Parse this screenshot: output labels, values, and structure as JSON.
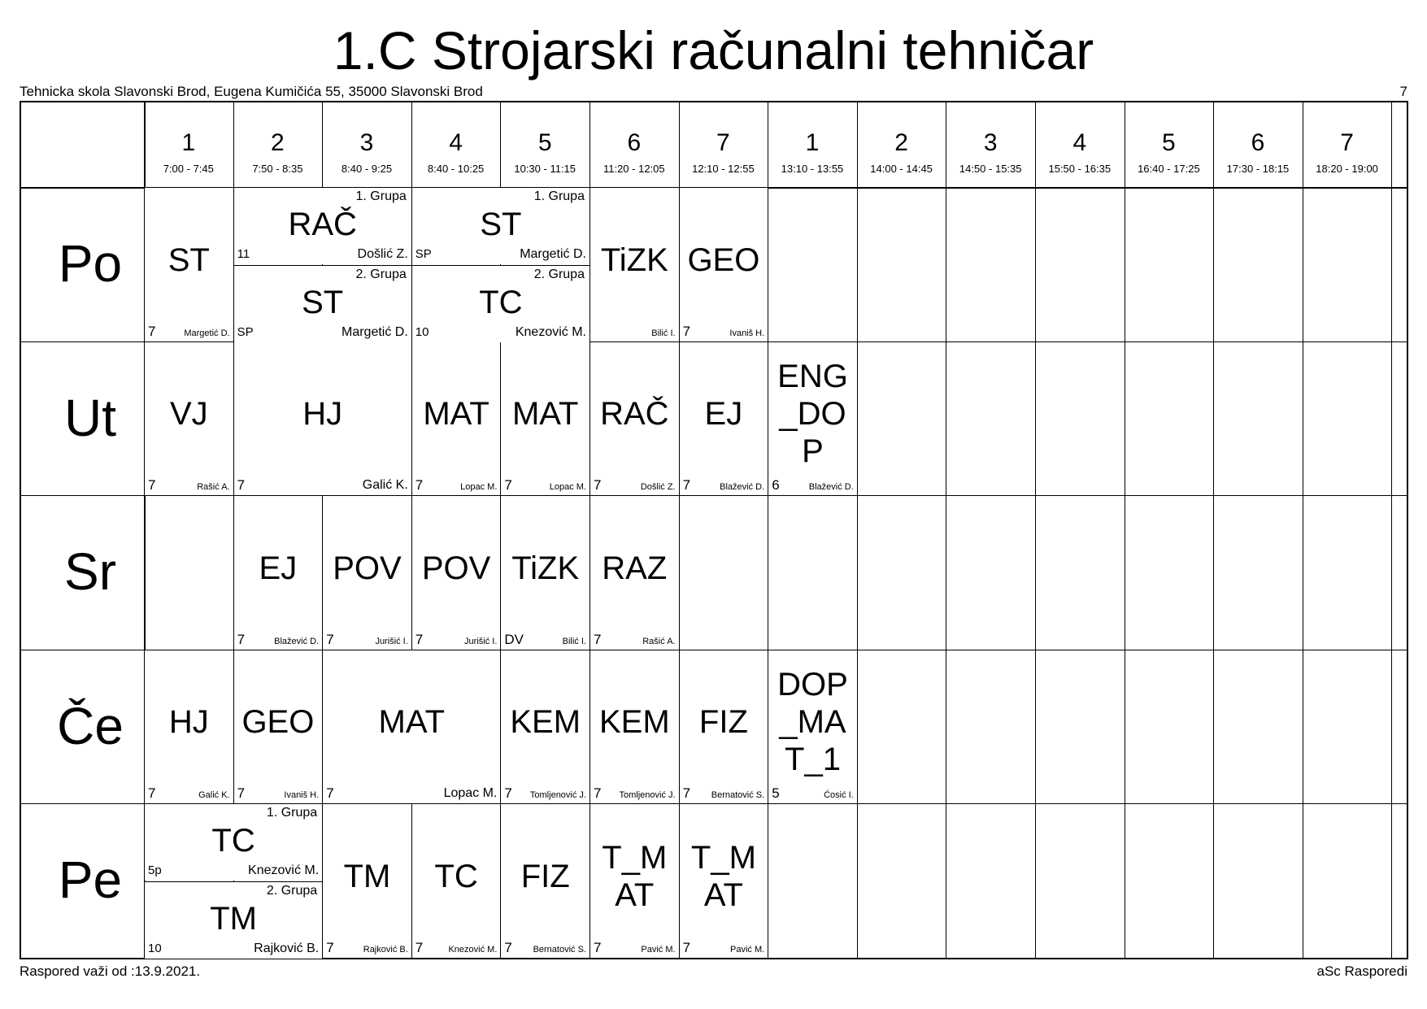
{
  "title": "1.C Strojarski računalni tehničar",
  "school": "Tehnicka skola Slavonski Brod, Eugena Kumičića 55, 35000 Slavonski Brod",
  "page_number": "7",
  "footer_left": "Raspored važi od :13.9.2021.",
  "footer_right": "aSc Rasporedi",
  "periods": [
    {
      "num": "1",
      "time": "7:00 - 7:45"
    },
    {
      "num": "2",
      "time": "7:50 - 8:35"
    },
    {
      "num": "3",
      "time": "8:40 - 9:25"
    },
    {
      "num": "4",
      "time": "8:40 - 10:25"
    },
    {
      "num": "5",
      "time": "10:30 - 11:15"
    },
    {
      "num": "6",
      "time": "11:20 - 12:05"
    },
    {
      "num": "7",
      "time": "12:10 - 12:55"
    },
    {
      "num": "1",
      "time": "13:10 - 13:55"
    },
    {
      "num": "2",
      "time": "14:00 - 14:45"
    },
    {
      "num": "3",
      "time": "14:50 - 15:35"
    },
    {
      "num": "4",
      "time": "15:50 - 16:35"
    },
    {
      "num": "5",
      "time": "16:40 - 17:25"
    },
    {
      "num": "6",
      "time": "17:30 - 18:15"
    },
    {
      "num": "7",
      "time": "18:20 - 19:00"
    }
  ],
  "days": [
    "Po",
    "Ut",
    "Sr",
    "Če",
    "Pe"
  ],
  "lessons": [
    {
      "day": 0,
      "start": 0,
      "span": 1,
      "half": "",
      "subject": [
        "ST"
      ],
      "room": "7",
      "teacher": "Margetić D.",
      "group": ""
    },
    {
      "day": 0,
      "start": 1,
      "span": 2,
      "half": "top",
      "subject": [
        "RAČ"
      ],
      "room": "11",
      "teacher": "Došlić Z.",
      "group": "1. Grupa"
    },
    {
      "day": 0,
      "start": 1,
      "span": 2,
      "half": "bottom",
      "subject": [
        "ST"
      ],
      "room": "SP",
      "teacher": "Margetić D.",
      "group": "2. Grupa"
    },
    {
      "day": 0,
      "start": 3,
      "span": 2,
      "half": "top",
      "subject": [
        "ST"
      ],
      "room": "SP",
      "teacher": "Margetić D.",
      "group": "1. Grupa"
    },
    {
      "day": 0,
      "start": 3,
      "span": 2,
      "half": "bottom",
      "subject": [
        "TC"
      ],
      "room": "10",
      "teacher": "Knezović M.",
      "group": "2. Grupa"
    },
    {
      "day": 0,
      "start": 5,
      "span": 1,
      "half": "",
      "subject": [
        "TiZK"
      ],
      "room": "",
      "teacher": "Bilić I.",
      "group": ""
    },
    {
      "day": 0,
      "start": 6,
      "span": 1,
      "half": "",
      "subject": [
        "GEO"
      ],
      "room": "7",
      "teacher": "Ivaniš H.",
      "group": ""
    },
    {
      "day": 1,
      "start": 0,
      "span": 1,
      "half": "",
      "subject": [
        "VJ"
      ],
      "room": "7",
      "teacher": "Rašić A.",
      "group": ""
    },
    {
      "day": 1,
      "start": 1,
      "span": 2,
      "half": "",
      "subject": [
        "HJ"
      ],
      "room": "7",
      "teacher": "Galić K.",
      "group": ""
    },
    {
      "day": 1,
      "start": 3,
      "span": 1,
      "half": "",
      "subject": [
        "MAT"
      ],
      "room": "7",
      "teacher": "Lopac M.",
      "group": ""
    },
    {
      "day": 1,
      "start": 4,
      "span": 1,
      "half": "",
      "subject": [
        "MAT"
      ],
      "room": "7",
      "teacher": "Lopac M.",
      "group": ""
    },
    {
      "day": 1,
      "start": 5,
      "span": 1,
      "half": "",
      "subject": [
        "RAČ"
      ],
      "room": "7",
      "teacher": "Došlić Z.",
      "group": ""
    },
    {
      "day": 1,
      "start": 6,
      "span": 1,
      "half": "",
      "subject": [
        "EJ"
      ],
      "room": "7",
      "teacher": "Blažević D.",
      "group": ""
    },
    {
      "day": 1,
      "start": 7,
      "span": 1,
      "half": "",
      "subject": [
        "ENG",
        "_DO",
        "P"
      ],
      "room": "6",
      "teacher": "Blažević D.",
      "group": ""
    },
    {
      "day": 2,
      "start": 1,
      "span": 1,
      "half": "",
      "subject": [
        "EJ"
      ],
      "room": "7",
      "teacher": "Blažević D.",
      "group": ""
    },
    {
      "day": 2,
      "start": 2,
      "span": 1,
      "half": "",
      "subject": [
        "POV"
      ],
      "room": "7",
      "teacher": "Jurišić I.",
      "group": ""
    },
    {
      "day": 2,
      "start": 3,
      "span": 1,
      "half": "",
      "subject": [
        "POV"
      ],
      "room": "7",
      "teacher": "Jurišić I.",
      "group": ""
    },
    {
      "day": 2,
      "start": 4,
      "span": 1,
      "half": "",
      "subject": [
        "TiZK"
      ],
      "room": "DV",
      "teacher": "Bilić I.",
      "group": ""
    },
    {
      "day": 2,
      "start": 5,
      "span": 1,
      "half": "",
      "subject": [
        "RAZ"
      ],
      "room": "7",
      "teacher": "Rašić A.",
      "group": ""
    },
    {
      "day": 3,
      "start": 0,
      "span": 1,
      "half": "",
      "subject": [
        "HJ"
      ],
      "room": "7",
      "teacher": "Galić K.",
      "group": ""
    },
    {
      "day": 3,
      "start": 1,
      "span": 1,
      "half": "",
      "subject": [
        "GEO"
      ],
      "room": "7",
      "teacher": "Ivaniš H.",
      "group": ""
    },
    {
      "day": 3,
      "start": 2,
      "span": 2,
      "half": "",
      "subject": [
        "MAT"
      ],
      "room": "7",
      "teacher": "Lopac M.",
      "group": ""
    },
    {
      "day": 3,
      "start": 4,
      "span": 1,
      "half": "",
      "subject": [
        "KEM"
      ],
      "room": "7",
      "teacher": "Tomljenović J.",
      "group": ""
    },
    {
      "day": 3,
      "start": 5,
      "span": 1,
      "half": "",
      "subject": [
        "KEM"
      ],
      "room": "7",
      "teacher": "Tomljenović J.",
      "group": ""
    },
    {
      "day": 3,
      "start": 6,
      "span": 1,
      "half": "",
      "subject": [
        "FIZ"
      ],
      "room": "7",
      "teacher": "Bernatović S.",
      "group": ""
    },
    {
      "day": 3,
      "start": 7,
      "span": 1,
      "half": "",
      "subject": [
        "DOP",
        "_MA",
        "T_1"
      ],
      "room": "5",
      "teacher": "Ćosić I.",
      "group": ""
    },
    {
      "day": 4,
      "start": 0,
      "span": 2,
      "half": "top",
      "subject": [
        "TC"
      ],
      "room": "5p",
      "teacher": "Knezović M.",
      "group": "1. Grupa"
    },
    {
      "day": 4,
      "start": 0,
      "span": 2,
      "half": "bottom",
      "subject": [
        "TM"
      ],
      "room": "10",
      "teacher": "Rajković B.",
      "group": "2. Grupa"
    },
    {
      "day": 4,
      "start": 2,
      "span": 1,
      "half": "",
      "subject": [
        "TM"
      ],
      "room": "7",
      "teacher": "Rajković B.",
      "group": ""
    },
    {
      "day": 4,
      "start": 3,
      "span": 1,
      "half": "",
      "subject": [
        "TC"
      ],
      "room": "7",
      "teacher": "Knezović M.",
      "group": ""
    },
    {
      "day": 4,
      "start": 4,
      "span": 1,
      "half": "",
      "subject": [
        "FIZ"
      ],
      "room": "7",
      "teacher": "Bernatović S.",
      "group": ""
    },
    {
      "day": 4,
      "start": 5,
      "span": 1,
      "half": "",
      "subject": [
        "T_M",
        "AT"
      ],
      "room": "7",
      "teacher": "Pavić M.",
      "group": ""
    },
    {
      "day": 4,
      "start": 6,
      "span": 1,
      "half": "",
      "subject": [
        "T_M",
        "AT"
      ],
      "room": "7",
      "teacher": "Pavić M.",
      "group": ""
    }
  ]
}
